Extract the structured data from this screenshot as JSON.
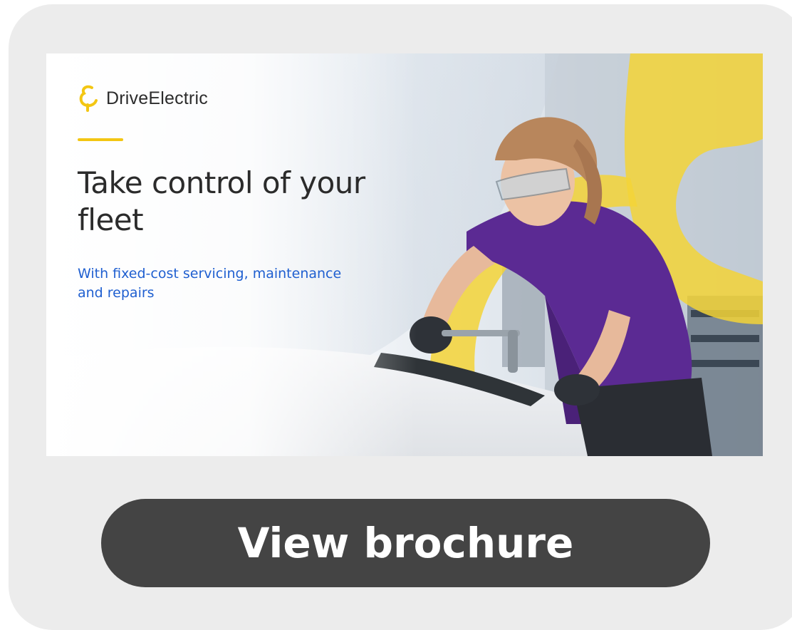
{
  "banner": {
    "brand_name": "DriveElectric",
    "brand_icon": "driveelectric-logo-icon",
    "headline": "Take control of your fleet",
    "subline": "With fixed-cost servicing, maintenance and repairs"
  },
  "cta": {
    "label": "View brochure"
  },
  "colors": {
    "accent_yellow": "#f3c613",
    "subline_blue": "#1f5fd0",
    "button_bg": "#444444",
    "card_bg": "#ececec",
    "shirt_purple": "#5b2a93"
  }
}
